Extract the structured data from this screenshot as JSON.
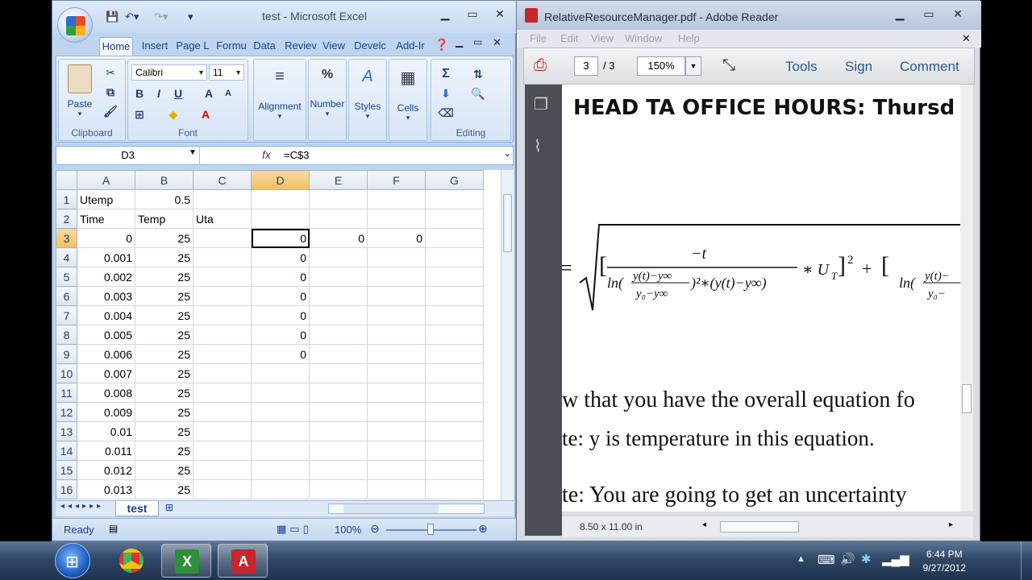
{
  "excel": {
    "caption": "test - Microsoft Excel",
    "tabs": [
      "Home",
      "Insert",
      "Page L",
      "Formu",
      "Data",
      "Reviev",
      "View",
      "Develc",
      "Add-Ir"
    ],
    "ribbon": {
      "paste": "Paste",
      "clipboard": "Clipboard",
      "font_name": "Calibri",
      "font_size": "11",
      "font": "Font",
      "alignment": "Alignment",
      "number": "Number",
      "styles": "Styles",
      "cells": "Cells",
      "editing": "Editing"
    },
    "name_box": "D3",
    "fx": "fx",
    "formula": "=C$3",
    "columns": [
      "A",
      "B",
      "C",
      "D",
      "E",
      "F",
      "G"
    ],
    "rows": [
      {
        "n": "1",
        "a": "Utemp",
        "b": "0.5",
        "c": "",
        "d": "",
        "e": "",
        "f": ""
      },
      {
        "n": "2",
        "a": "Time",
        "b": "Temp",
        "c": "Uta",
        "d": "",
        "e": "",
        "f": ""
      },
      {
        "n": "3",
        "a": "0",
        "b": "25",
        "c": "",
        "d": "0",
        "e": "0",
        "f": "0"
      },
      {
        "n": "4",
        "a": "0.001",
        "b": "25",
        "c": "",
        "d": "0",
        "e": "",
        "f": ""
      },
      {
        "n": "5",
        "a": "0.002",
        "b": "25",
        "c": "",
        "d": "0",
        "e": "",
        "f": ""
      },
      {
        "n": "6",
        "a": "0.003",
        "b": "25",
        "c": "",
        "d": "0",
        "e": "",
        "f": ""
      },
      {
        "n": "7",
        "a": "0.004",
        "b": "25",
        "c": "",
        "d": "0",
        "e": "",
        "f": ""
      },
      {
        "n": "8",
        "a": "0.005",
        "b": "25",
        "c": "",
        "d": "0",
        "e": "",
        "f": ""
      },
      {
        "n": "9",
        "a": "0.006",
        "b": "25",
        "c": "",
        "d": "0",
        "e": "",
        "f": ""
      },
      {
        "n": "10",
        "a": "0.007",
        "b": "25",
        "c": "",
        "d": "",
        "e": "",
        "f": ""
      },
      {
        "n": "11",
        "a": "0.008",
        "b": "25",
        "c": "",
        "d": "",
        "e": "",
        "f": ""
      },
      {
        "n": "12",
        "a": "0.009",
        "b": "25",
        "c": "",
        "d": "",
        "e": "",
        "f": ""
      },
      {
        "n": "13",
        "a": "0.01",
        "b": "25",
        "c": "",
        "d": "",
        "e": "",
        "f": ""
      },
      {
        "n": "14",
        "a": "0.011",
        "b": "25",
        "c": "",
        "d": "",
        "e": "",
        "f": ""
      },
      {
        "n": "15",
        "a": "0.012",
        "b": "25",
        "c": "",
        "d": "",
        "e": "",
        "f": ""
      },
      {
        "n": "16",
        "a": "0.013",
        "b": "25",
        "c": "",
        "d": "",
        "e": "",
        "f": ""
      }
    ],
    "sheet_tab": "test",
    "status": "Ready",
    "zoom": "100%"
  },
  "adobe": {
    "caption": "RelativeResourceManager.pdf - Adobe Reader",
    "menu": [
      "File",
      "Edit",
      "View",
      "Window",
      "Help"
    ],
    "page_current": "3",
    "page_total": "/ 3",
    "zoom": "150%",
    "tools": "Tools",
    "sign": "Sign",
    "comment": "Comment",
    "heading": "HEAD TA OFFICE HOURS: Thursd",
    "line1": "w that you have the overall equation fo",
    "line2": "te: y is temperature in this equation.",
    "line3": "te: You are going to get an uncertainty",
    "page_size": "8.50 x 11.00 in"
  },
  "taskbar": {
    "time": "6:44 PM",
    "date": "9/27/2012"
  }
}
